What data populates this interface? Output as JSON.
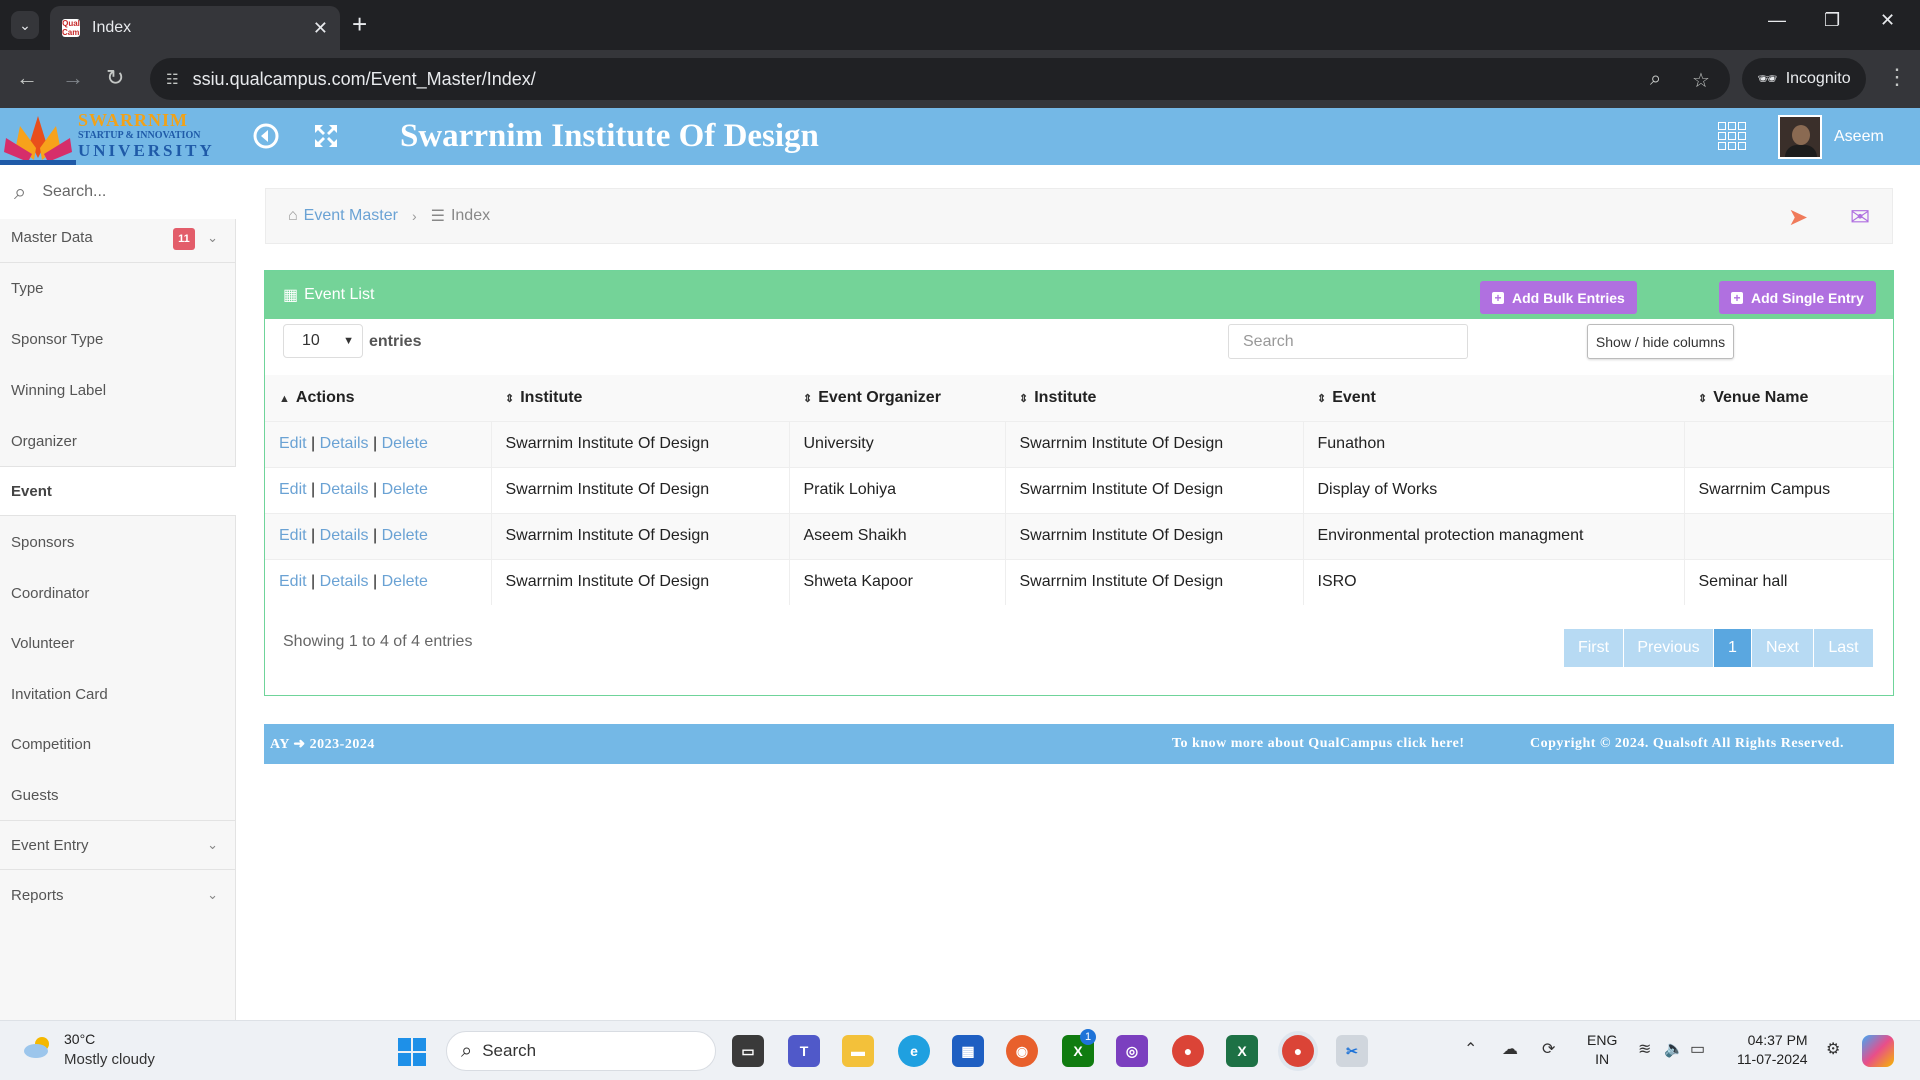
{
  "browser": {
    "tab_title": "Index",
    "tab_favicon_text": "Qual Campus",
    "url": "ssiu.qualcampus.com/Event_Master/Index/",
    "incognito_label": "Incognito"
  },
  "header": {
    "logo_name": "SWARRNIM",
    "logo_tagline": "STARTUP & INNOVATION",
    "logo_university": "UNIVERSITY",
    "title": "Swarrnim Institute Of Design",
    "user_name": "Aseem"
  },
  "sidebar": {
    "search_placeholder": "Search...",
    "group_master": "Master Data",
    "badge": "11",
    "items": [
      "Type",
      "Sponsor Type",
      "Winning Label",
      "Organizer",
      "Event",
      "Sponsors",
      "Coordinator",
      "Volunteer",
      "Invitation Card",
      "Competition",
      "Guests"
    ],
    "group_event_entry": "Event Entry",
    "group_reports": "Reports",
    "active_item": "Event"
  },
  "breadcrumb": {
    "parent": "Event Master",
    "current": "Index"
  },
  "panel": {
    "title": "Event List",
    "add_bulk": "Add Bulk Entries",
    "add_single": "Add Single Entry",
    "page_length": "10",
    "entries_label": "entries",
    "search_placeholder": "Search",
    "colvis_label": "Show / hide columns",
    "columns": [
      "Actions",
      "Institute",
      "Event Organizer",
      "Institute",
      "Event",
      "Venue Name"
    ],
    "action_labels": {
      "edit": "Edit",
      "details": "Details",
      "delete": "Delete",
      "sep": "|"
    },
    "rows": [
      [
        "Swarrnim Institute Of Design",
        "University",
        "Swarrnim Institute Of Design",
        "Funathon",
        ""
      ],
      [
        "Swarrnim Institute Of Design",
        "Pratik Lohiya",
        "Swarrnim Institute Of Design",
        "Display of Works",
        "Swarrnim Campus"
      ],
      [
        "Swarrnim Institute Of Design",
        "Aseem Shaikh",
        "Swarrnim Institute Of Design",
        "Environmental protection managment",
        ""
      ],
      [
        "Swarrnim Institute Of Design",
        "Shweta Kapoor",
        "Swarrnim Institute Of Design",
        "ISRO",
        "Seminar hall"
      ]
    ],
    "info": "Showing 1 to 4 of 4 entries",
    "pager": {
      "first": "First",
      "previous": "Previous",
      "current": "1",
      "next": "Next",
      "last": "Last"
    }
  },
  "footer": {
    "ay_label": "AY",
    "ay_value": "2023-2024",
    "more": "To know more about QualCampus click here!",
    "copyright": "Copyright © 2024. Qualsoft All Rights Reserved."
  },
  "taskbar": {
    "temperature": "30°C",
    "weather": "Mostly cloudy",
    "search_label": "Search",
    "lang_top": "ENG",
    "lang_bottom": "IN",
    "time": "04:37 PM",
    "date": "11-07-2024",
    "xbox_badge": "1"
  },
  "colors": {
    "header_blue": "#74b8e6",
    "panel_green": "#74d398",
    "button_purple": "#b070e0",
    "link_blue": "#6aa2d4",
    "badge_red": "#e35d6a"
  }
}
